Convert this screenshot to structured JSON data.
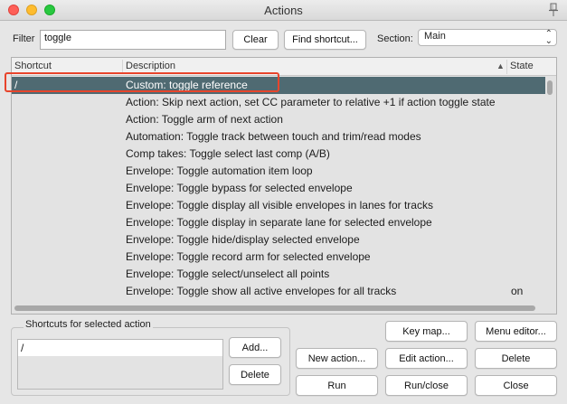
{
  "window": {
    "title": "Actions"
  },
  "filter": {
    "label": "Filter",
    "value": "toggle"
  },
  "buttons": {
    "clear": "Clear",
    "find_shortcut": "Find shortcut...",
    "add": "Add...",
    "delete_shortcut": "Delete",
    "key_map": "Key map...",
    "menu_editor": "Menu editor...",
    "new_action": "New action...",
    "edit_action": "Edit action...",
    "delete_action": "Delete",
    "run": "Run",
    "run_close": "Run/close",
    "close": "Close"
  },
  "section": {
    "label": "Section:",
    "value": "Main"
  },
  "table": {
    "columns": {
      "shortcut": "Shortcut",
      "description": "Description",
      "state": "State"
    },
    "rows": [
      {
        "shortcut": "/",
        "description": "Custom: toggle reference",
        "state": ""
      },
      {
        "shortcut": "",
        "description": "Action: Skip next action, set CC parameter to relative +1 if action toggle state",
        "state": ""
      },
      {
        "shortcut": "",
        "description": "Action: Toggle arm of next action",
        "state": ""
      },
      {
        "shortcut": "",
        "description": "Automation: Toggle track between touch and trim/read modes",
        "state": ""
      },
      {
        "shortcut": "",
        "description": "Comp takes: Toggle select last comp (A/B)",
        "state": ""
      },
      {
        "shortcut": "",
        "description": "Envelope: Toggle automation item loop",
        "state": ""
      },
      {
        "shortcut": "",
        "description": "Envelope: Toggle bypass for selected envelope",
        "state": ""
      },
      {
        "shortcut": "",
        "description": "Envelope: Toggle display all visible envelopes in lanes for tracks",
        "state": ""
      },
      {
        "shortcut": "",
        "description": "Envelope: Toggle display in separate lane for selected envelope",
        "state": ""
      },
      {
        "shortcut": "",
        "description": "Envelope: Toggle hide/display selected envelope",
        "state": ""
      },
      {
        "shortcut": "",
        "description": "Envelope: Toggle record arm for selected envelope",
        "state": ""
      },
      {
        "shortcut": "",
        "description": "Envelope: Toggle select/unselect all points",
        "state": ""
      },
      {
        "shortcut": "",
        "description": "Envelope: Toggle show all active envelopes for all tracks",
        "state": "on"
      }
    ]
  },
  "shortcuts_group": {
    "title": "Shortcuts for selected action",
    "items": [
      "/"
    ]
  },
  "icons": {
    "pin": "pin-icon",
    "sort": "sort-ascending-icon",
    "section_dropdown": "chevron-updown-icon"
  },
  "colors": {
    "selection": "#4f6a72",
    "highlight": "#e8452c"
  }
}
